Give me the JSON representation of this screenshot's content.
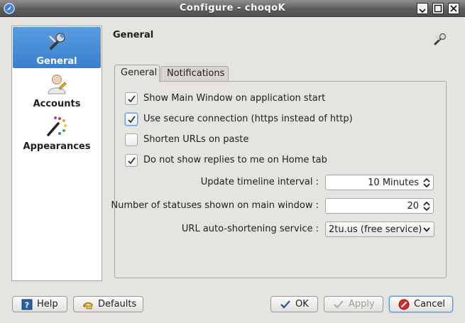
{
  "window": {
    "title": "Configure - choqoK"
  },
  "sidebar": {
    "items": [
      {
        "label": "General",
        "icon": "wrench-icon",
        "active": true
      },
      {
        "label": "Accounts",
        "icon": "user-icon",
        "active": false
      },
      {
        "label": "Appearances",
        "icon": "paint-icon",
        "active": false
      }
    ]
  },
  "page": {
    "title": "General",
    "icon": "wrench-icon"
  },
  "tabs": [
    {
      "label": "General",
      "active": true
    },
    {
      "label": "Notifications",
      "active": false
    }
  ],
  "options": [
    {
      "label": "Show Main Window on application start",
      "checked": true
    },
    {
      "label": "Use secure connection (https instead of http)",
      "checked": true
    },
    {
      "label": "Shorten URLs on paste",
      "checked": false
    },
    {
      "label": "Do not show replies to me on Home tab",
      "checked": true
    }
  ],
  "fields": {
    "timeline_interval": {
      "label": "Update timeline interval :",
      "value": "10 Minutes"
    },
    "statuses_count": {
      "label": "Number of statuses shown on main window :",
      "value": "20"
    },
    "shortening_service": {
      "label": "URL auto-shortening service :",
      "value": "2tu.us (free service)"
    }
  },
  "buttons": {
    "help": "Help",
    "defaults": "Defaults",
    "ok": "OK",
    "apply": "Apply",
    "cancel": "Cancel"
  },
  "colors": {
    "selection": "#3a7fcf",
    "titlebar": "#5e5e5e",
    "window_bg": "#e6e4e1"
  }
}
